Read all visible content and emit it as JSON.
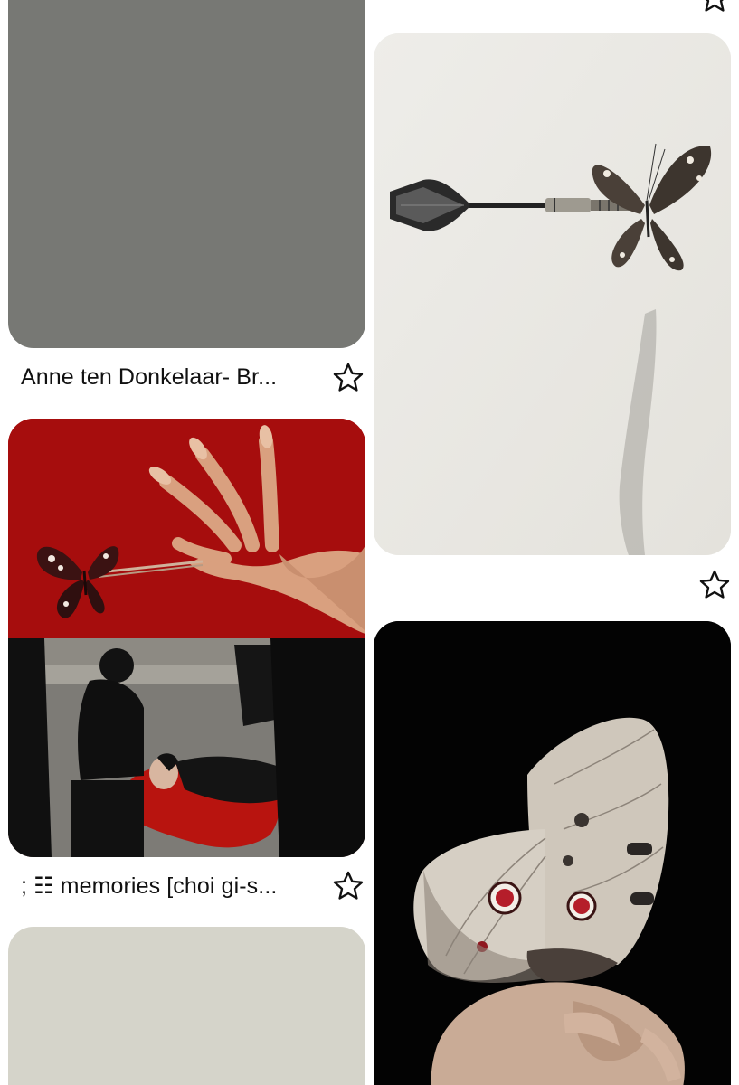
{
  "feed": {
    "left_column": [
      {
        "id": "pin-gray",
        "caption": "Anne ten Donkelaar- Br...",
        "placeholder_color": "#777874",
        "star_icon": "star-outline-icon"
      },
      {
        "id": "pin-memories",
        "caption": "; ☷ memories [choi gi-s...",
        "star_icon": "star-outline-icon"
      },
      {
        "id": "pin-beige",
        "placeholder_color": "#d5d4ca"
      }
    ],
    "right_column": [
      {
        "id": "pin-dart-butterfly",
        "star_icon": "star-outline-icon"
      },
      {
        "id": "pin-moth-figure"
      }
    ]
  },
  "colors": {
    "background": "#ffffff",
    "caption_text": "#111111",
    "icon_stroke": "#111111",
    "red_backdrop": "#a80e0e",
    "blood_red": "#b8140f",
    "black_backdrop": "#030303"
  }
}
